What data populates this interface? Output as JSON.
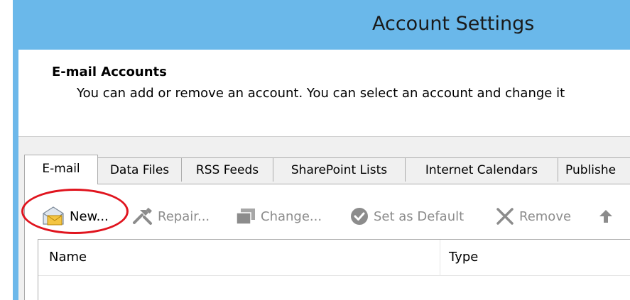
{
  "window": {
    "title": "Account Settings"
  },
  "header": {
    "title": "E-mail Accounts",
    "description": "You can add or remove an account. You can select an account and change it"
  },
  "tabs": [
    {
      "label": "E-mail",
      "active": true
    },
    {
      "label": "Data Files",
      "active": false
    },
    {
      "label": "RSS Feeds",
      "active": false
    },
    {
      "label": "SharePoint Lists",
      "active": false
    },
    {
      "label": "Internet Calendars",
      "active": false
    },
    {
      "label": "Publishe",
      "active": false
    }
  ],
  "toolbar": {
    "new_label": "New...",
    "new_icon": "new-account-envelope-icon",
    "repair_label": "Repair...",
    "repair_icon": "tools-icon",
    "change_label": "Change...",
    "change_icon": "change-icon",
    "default_label": "Set as Default",
    "default_icon": "checkmark-circle-icon",
    "remove_label": "Remove",
    "remove_icon": "x-icon",
    "move_up_icon": "arrow-up-icon"
  },
  "list": {
    "columns": [
      "Name",
      "Type"
    ]
  },
  "colors": {
    "titlebar": "#6ab8ea",
    "annotation": "#e0141e",
    "disabled_text": "#8c8c8c"
  }
}
